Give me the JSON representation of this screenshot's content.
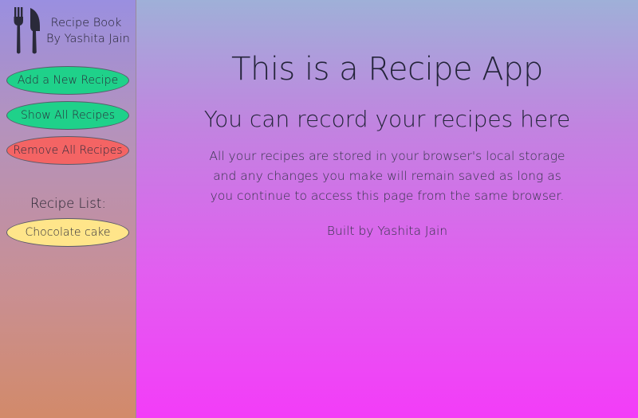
{
  "sidebar": {
    "brand": {
      "icon": "cutlery-icon",
      "title_line1": "Recipe Book",
      "title_line2": "By Yashita Jain"
    },
    "buttons": {
      "add": "Add a New Recipe",
      "show": "Show All Recipes",
      "remove": "Remove All Recipes"
    },
    "recipe_list_heading": "Recipe List:",
    "recipes": [
      "Chocolate cake"
    ]
  },
  "main": {
    "title": "This is a Recipe App",
    "subtitle": "You can record your recipes here",
    "description": "All your recipes are stored in your browser's local storage and any changes you make will remain saved as long as you continue to access this page from the same browser.",
    "credit": "Built by Yashita Jain"
  },
  "colors": {
    "button_green": "#1fd18a",
    "button_red": "#f46464",
    "recipe_yellow": "#ffe58a",
    "icon_dark": "#2a2a3a"
  }
}
